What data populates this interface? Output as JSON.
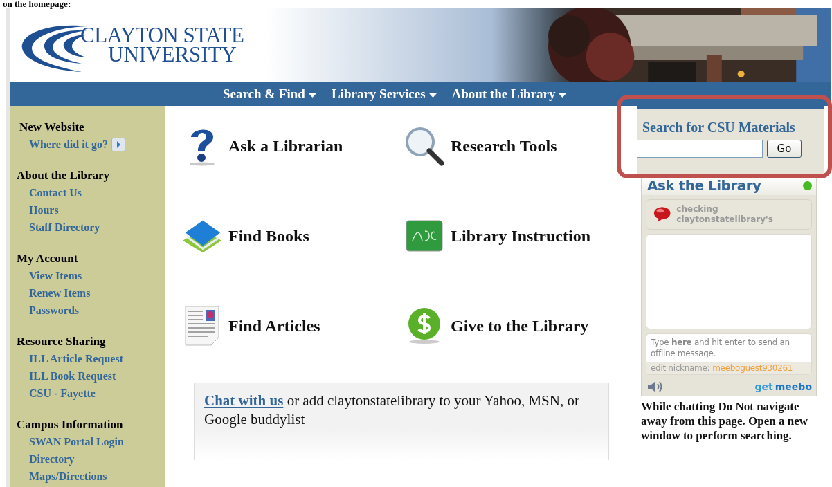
{
  "caption": "on the homepage:",
  "header": {
    "logo_line_1": "CLAYTON STATE",
    "logo_line_2": "UNIVERSITY"
  },
  "nav": [
    {
      "label": "Search & Find"
    },
    {
      "label": "Library Services"
    },
    {
      "label": "About the Library"
    }
  ],
  "sidebar": {
    "sections": [
      {
        "heading": "New Website",
        "links": [
          {
            "label": "Where did it go?",
            "kind": "arrow"
          }
        ]
      },
      {
        "heading": "About the Library",
        "links": [
          {
            "label": "Contact Us",
            "kind": "plain"
          },
          {
            "label": "Hours",
            "kind": "plain"
          },
          {
            "label": "Staff Directory",
            "kind": "plain"
          }
        ]
      },
      {
        "heading": "My Account",
        "links": [
          {
            "label": "View Items",
            "kind": "plain"
          },
          {
            "label": "Renew Items",
            "kind": "plain"
          },
          {
            "label": "Passwords",
            "kind": "plain"
          }
        ]
      },
      {
        "heading": "Resource Sharing",
        "links": [
          {
            "label": "ILL Article Request",
            "kind": "plain"
          },
          {
            "label": "ILL Book Request",
            "kind": "plain"
          },
          {
            "label": "CSU - Fayette",
            "kind": "plain"
          }
        ]
      },
      {
        "heading": "Campus Information",
        "links": [
          {
            "label": "SWAN Portal Login",
            "kind": "plain"
          },
          {
            "label": "Directory",
            "kind": "plain"
          },
          {
            "label": "Maps/Directions",
            "kind": "plain"
          }
        ]
      }
    ]
  },
  "features": [
    {
      "label": "Ask a Librarian"
    },
    {
      "label": "Research Tools"
    },
    {
      "label": "Find Books"
    },
    {
      "label": "Library Instruction"
    },
    {
      "label": "Find Articles"
    },
    {
      "label": "Give to the Library"
    }
  ],
  "chat_box": {
    "link": "Chat with us",
    "text": " or add claytonstatelibrary to your Yahoo, MSN, or Google buddylist"
  },
  "search": {
    "title": "Search for CSU Materials",
    "button": "Go"
  },
  "widget": {
    "title": "Ask the Library",
    "online": true,
    "status": "checking claytonstatelibrary's",
    "input_hint": "Type **here** and hit enter to send an offline message.",
    "nickname_label": "edit nickname:",
    "nickname": "meeboguest930261",
    "brand_1": "get",
    "brand_2": "meebo"
  },
  "note": "While chatting Do Not navigate away from this page. Open a new window to perform searching."
}
